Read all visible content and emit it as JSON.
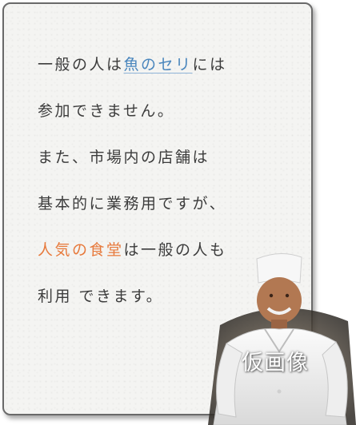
{
  "lines": {
    "l1_pre": "一般の人は",
    "l1_link": "魚のセリ",
    "l1_post": "には",
    "l2": "参加できません。",
    "l3": "また、市場内の店舗は",
    "l4": "基本的に業務用ですが、",
    "l5_hl": "人気の食堂",
    "l5_post": "は一般の人も",
    "l6": "利用 できます。"
  },
  "photo": {
    "caption": "仮画像",
    "subject": "chef-photo"
  },
  "colors": {
    "text": "#3c3c3c",
    "link_blue": "#4a86bd",
    "highlight_orange": "#e7793b",
    "card_background": "#f4f4f2"
  }
}
